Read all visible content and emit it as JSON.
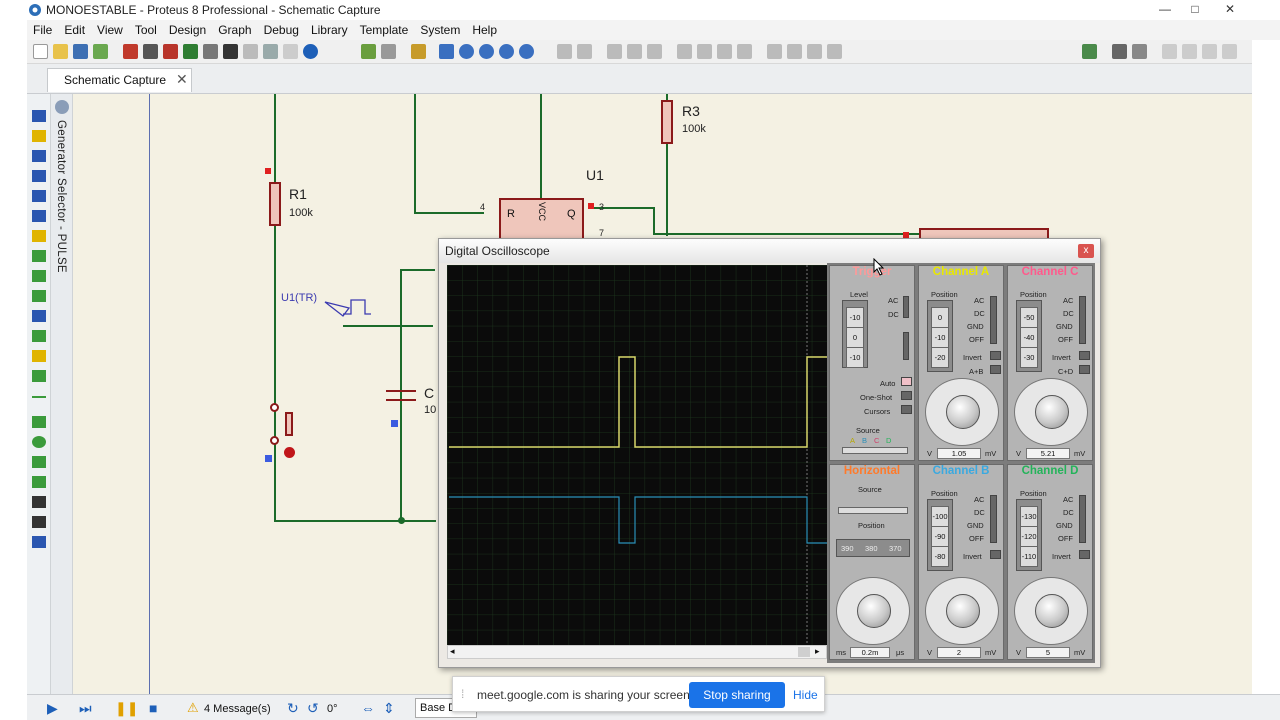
{
  "window": {
    "title": "MONOESTABLE - Proteus 8 Professional - Schematic Capture",
    "controls": [
      "—",
      "□",
      "✕"
    ]
  },
  "menu": [
    "File",
    "Edit",
    "View",
    "Tool",
    "Design",
    "Graph",
    "Debug",
    "Library",
    "Template",
    "System",
    "Help"
  ],
  "tab": {
    "label": "Schematic Capture",
    "close": "✕"
  },
  "generator_panel": {
    "label": "Generator Selector - PULSE"
  },
  "schematic": {
    "r1": {
      "name": "R1",
      "value": "100k"
    },
    "r3": {
      "name": "R3",
      "value": "100k"
    },
    "u1": {
      "name": "U1",
      "pin_r": "R",
      "pin_vcc": "VCC",
      "pin_q": "Q",
      "pin4": "4",
      "pin3": "3",
      "pin7": "7"
    },
    "probe": "U1(TR)",
    "cap": {
      "name": "C",
      "value": "10"
    }
  },
  "oscilloscope": {
    "title": "Digital Oscilloscope",
    "close": "x",
    "trigger": {
      "label": "Trigger",
      "level": "Level",
      "level_values": [
        "-10",
        "0",
        "-10"
      ],
      "ac": "AC",
      "dc": "DC",
      "auto": "Auto",
      "one_shot": "One-Shot",
      "cursors": "Cursors",
      "source": "Source",
      "source_letters": [
        "A",
        "B",
        "C",
        "D"
      ]
    },
    "channel_a": {
      "label": "Channel A",
      "color": "#e8e800",
      "position": "Position",
      "values": [
        "0",
        "-10",
        "-20"
      ],
      "modes": [
        "AC",
        "DC",
        "GND",
        "OFF"
      ],
      "invert": "Invert",
      "math": "A+B",
      "readout": "1.05",
      "unit_left": "V",
      "unit_right": "mV"
    },
    "channel_c": {
      "label": "Channel C",
      "color": "#ff5a8c",
      "position": "Position",
      "values": [
        "-50",
        "-40",
        "-30"
      ],
      "modes": [
        "AC",
        "DC",
        "GND",
        "OFF"
      ],
      "invert": "Invert",
      "math": "C+D",
      "readout": "5.21",
      "unit_left": "V",
      "unit_right": "mV"
    },
    "horizontal": {
      "label": "Horizontal",
      "color": "#ff7a2a",
      "source": "Source",
      "position": "Position",
      "position_values": [
        "390",
        "380",
        "370"
      ],
      "readout": "0.2m",
      "unit_left": "ms",
      "unit_right": "μs"
    },
    "channel_b": {
      "label": "Channel B",
      "color": "#3aa9e0",
      "position": "Position",
      "values": [
        "-100",
        "-90",
        "-80"
      ],
      "modes": [
        "AC",
        "DC",
        "GND",
        "OFF"
      ],
      "invert": "Invert",
      "readout": "2",
      "unit_left": "V",
      "unit_right": "mV"
    },
    "channel_d": {
      "label": "Channel D",
      "color": "#24b35a",
      "position": "Position",
      "values": [
        "-130",
        "-120",
        "-110"
      ],
      "modes": [
        "AC",
        "DC",
        "GND",
        "OFF"
      ],
      "invert": "Invert",
      "readout": "5",
      "unit_left": "V",
      "unit_right": "mV"
    },
    "trace_colors": {
      "a": "#d8d66a",
      "b": "#2a8fb8"
    }
  },
  "statusbar": {
    "messages": "4 Message(s)",
    "angle": "0°",
    "base": "Base D"
  },
  "screen_share": {
    "text": "meet.google.com is sharing your screen.",
    "stop": "Stop sharing",
    "hide": "Hide"
  }
}
